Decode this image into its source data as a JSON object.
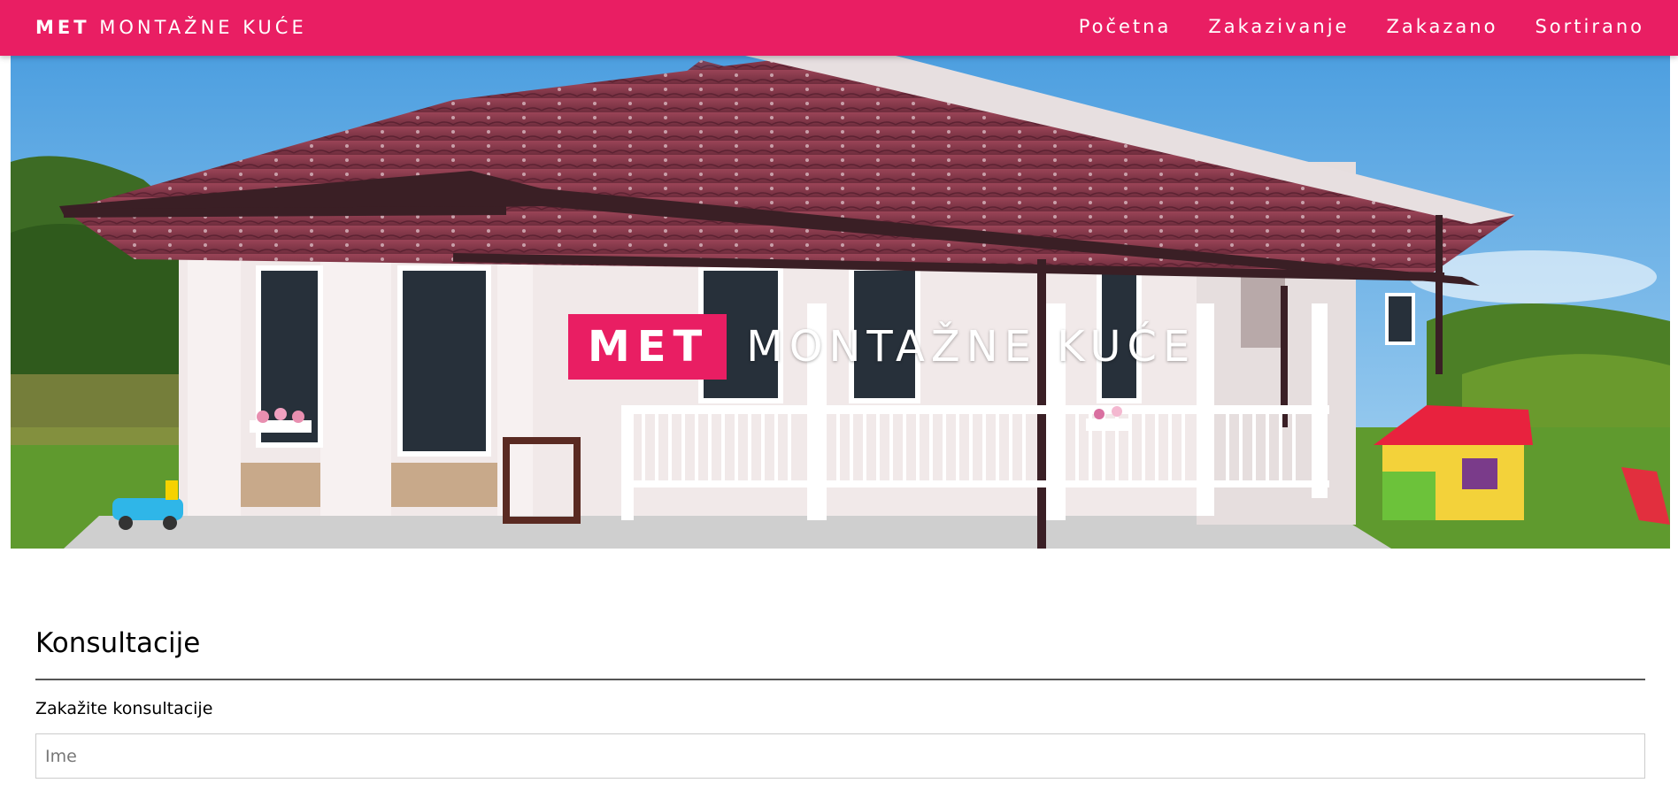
{
  "header": {
    "brand_bold": "MET",
    "brand_rest": "MONTAŽNE KUĆE",
    "nav": [
      {
        "label": "Početna"
      },
      {
        "label": "Zakazivanje"
      },
      {
        "label": "Zakazano"
      },
      {
        "label": "Sortirano"
      }
    ]
  },
  "hero": {
    "title_bold": "MET",
    "title_rest": "MONTAŽNE KUĆE"
  },
  "form": {
    "section_title": "Konsultacije",
    "subtitle": "Zakažite konsultacije",
    "name_placeholder": "Ime",
    "name_value": ""
  },
  "colors": {
    "accent": "#e91e63",
    "roof": "#8a3a4c",
    "wall": "#f3ecec",
    "sky": "#6fb3e6",
    "grass": "#5f9a2e"
  }
}
